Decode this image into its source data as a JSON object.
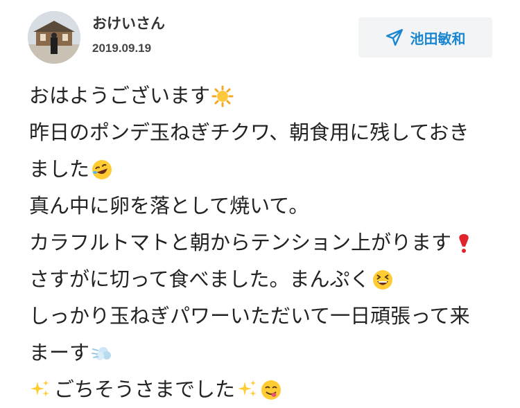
{
  "post": {
    "username": "おけいさん",
    "date": "2019.09.19",
    "mention_label": "池田敏和"
  },
  "icons": {
    "avatar": "avatar-photo",
    "mention": "paper-plane-icon",
    "sun": "sun-emoji",
    "rofl": "rolling-laughing-emoji",
    "heart_exclamation": "red-exclamation-emoji",
    "grin": "grinning-squinting-emoji",
    "dash": "dashing-away-emoji",
    "sparkles": "sparkles-emoji",
    "yum": "yum-face-emoji"
  },
  "colors": {
    "mention_text": "#1a86d0",
    "mention_bg": "#f3f4f6",
    "text": "#222222"
  },
  "lines": [
    "おはようございます",
    "昨日のポンデ玉ねぎチクワ、朝食用に残しておき",
    "ました",
    "真ん中に卵を落として焼いて。",
    "カラフルトマトと朝からテンション上がります",
    " さすがに切って食べました。まんぷく",
    "しっかり玉ねぎパワーいただいて一日頑張って来",
    "まーす",
    "ごちそうさまでした"
  ]
}
